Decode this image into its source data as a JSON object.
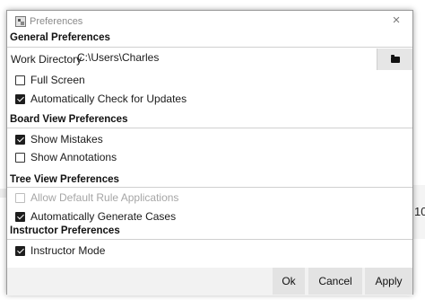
{
  "dialog": {
    "title": "Preferences",
    "close_glyph": "×"
  },
  "general": {
    "heading": "General Preferences",
    "work_directory_label": "Work Directory",
    "work_directory_value": "C:\\Users\\Charles",
    "browse_icon": "folder-icon",
    "full_screen": {
      "label": "Full Screen",
      "checked": false
    },
    "auto_check_updates": {
      "label": "Automatically Check for Updates",
      "checked": true
    }
  },
  "board_view": {
    "heading": "Board View Preferences",
    "show_mistakes": {
      "label": "Show Mistakes",
      "checked": true
    },
    "show_annotations": {
      "label": "Show Annotations",
      "checked": false
    }
  },
  "tree_view": {
    "heading": "Tree View Preferences",
    "allow_default_rule": {
      "label": "Allow Default Rule Applications",
      "checked": false,
      "disabled": true
    },
    "auto_generate_cases": {
      "label": "Automatically Generate Cases",
      "checked": true
    }
  },
  "instructor": {
    "heading": "Instructor Preferences",
    "instructor_mode": {
      "label": "Instructor Mode",
      "checked": true
    }
  },
  "buttons": {
    "ok": "Ok",
    "cancel": "Cancel",
    "apply": "Apply"
  },
  "background": {
    "partial_text": "10"
  }
}
